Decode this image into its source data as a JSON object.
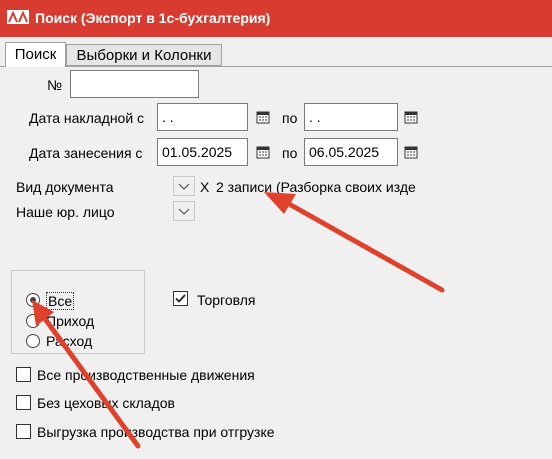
{
  "window": {
    "title": "Поиск (Экспорт в 1с-бухгалтерия)"
  },
  "tabs": [
    {
      "label": "Поиск",
      "active": true
    },
    {
      "label": "Выборки и Колонки",
      "active": false
    }
  ],
  "form": {
    "number_label": "№",
    "number_value": "",
    "invoice_date_label": "Дата накладной с",
    "invoice_date_from": " .  .",
    "invoice_date_to_label": "по",
    "invoice_date_to": " .  .",
    "entry_date_label": "Дата занесения с",
    "entry_date_from": "01.05.2025",
    "entry_date_to_label": "по",
    "entry_date_to": "06.05.2025",
    "doc_type_label": "Вид документа",
    "doc_type_clear": "X",
    "doc_type_value": "2 записи (Разборка своих изде",
    "legal_entity_label": "Наше юр. лицо"
  },
  "radio_group": {
    "options": [
      "Все",
      "Приход",
      "Расход"
    ],
    "selected": "Все"
  },
  "checkboxes": {
    "trade": {
      "label": "Торговля",
      "checked": true
    },
    "all_moves": {
      "label": "Все производственные движения",
      "checked": false
    },
    "no_workshop": {
      "label": "Без цеховых складов",
      "checked": false
    },
    "export_prod": {
      "label": "Выгрузка производства при отгрузке",
      "checked": false
    }
  },
  "colors": {
    "titlebar": "#d83c30",
    "annotation_arrow": "#e0412b"
  }
}
